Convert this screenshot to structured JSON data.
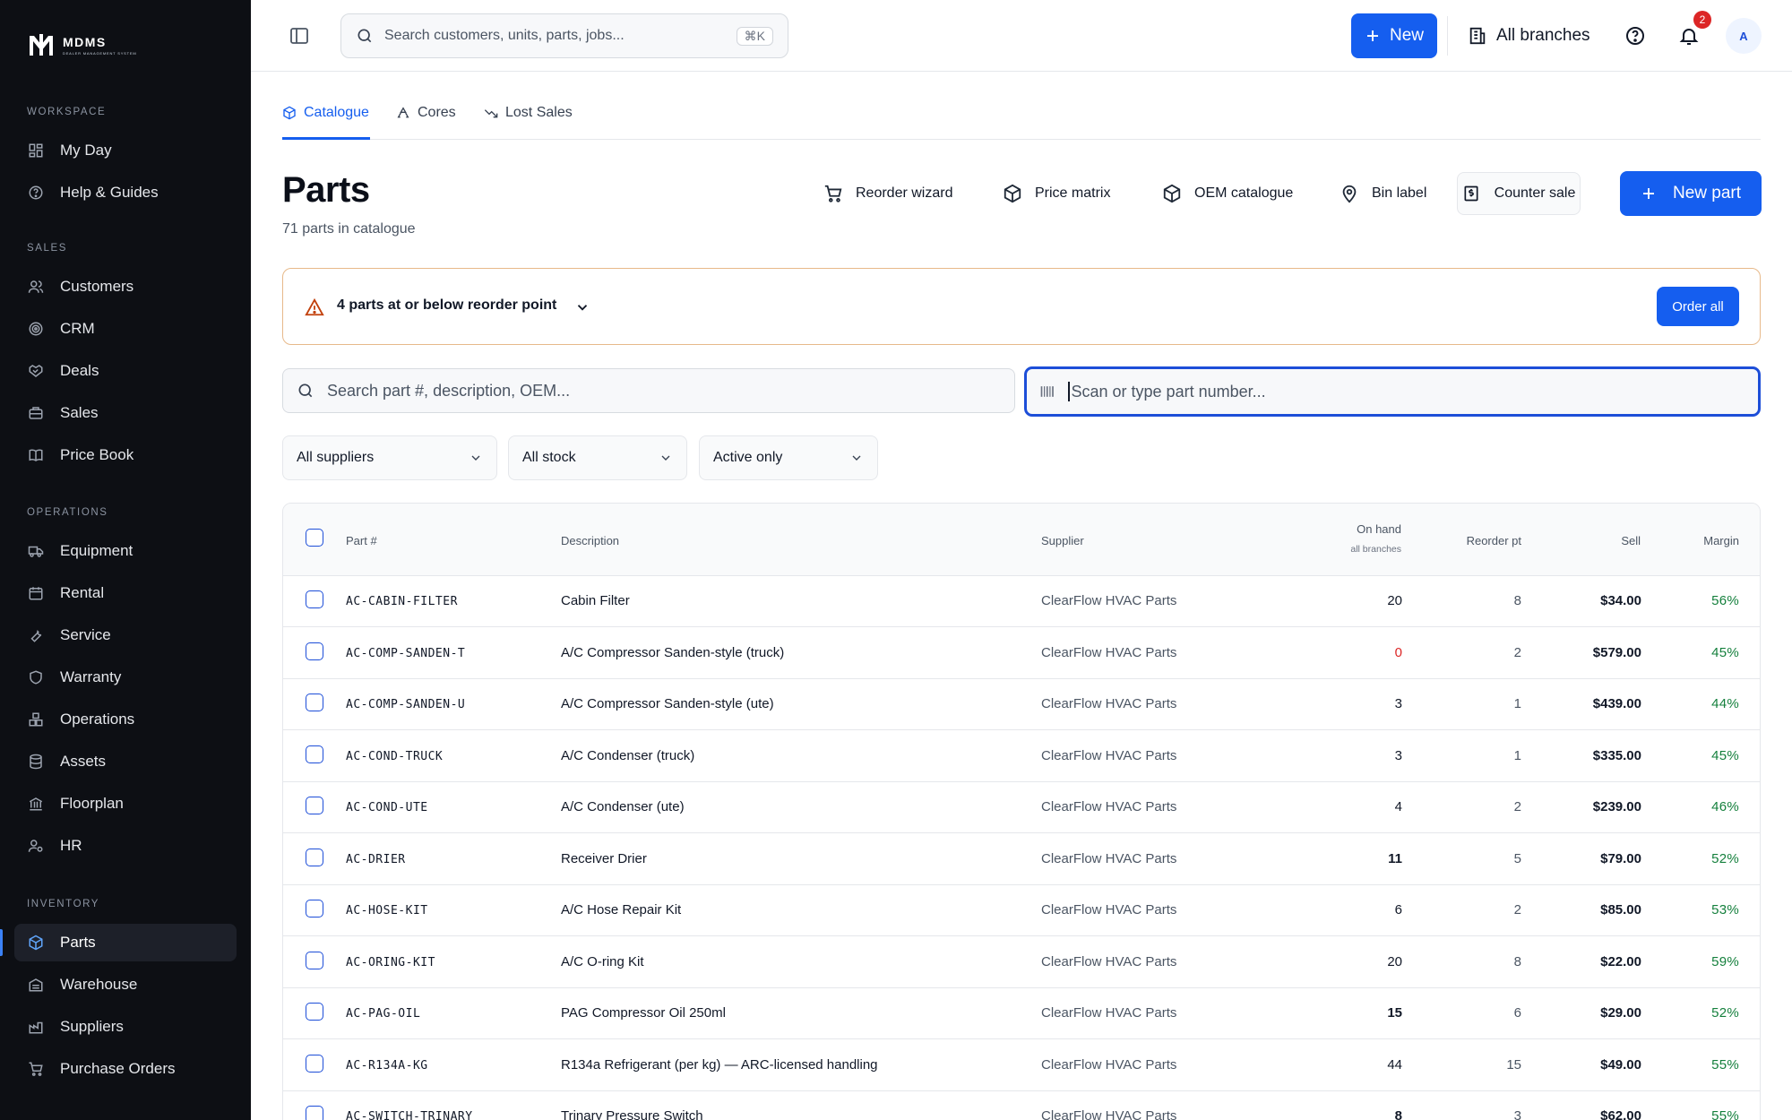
{
  "brand": {
    "name": "MDMS",
    "tagline": "Dealer Management System"
  },
  "sidebar": {
    "sections": [
      {
        "heading": "WORKSPACE",
        "items": [
          {
            "label": "My Day",
            "icon": "dashboard-icon"
          },
          {
            "label": "Help & Guides",
            "icon": "help-circle-icon"
          }
        ]
      },
      {
        "heading": "SALES",
        "items": [
          {
            "label": "Customers",
            "icon": "users-icon"
          },
          {
            "label": "CRM",
            "icon": "target-icon"
          },
          {
            "label": "Deals",
            "icon": "handshake-icon"
          },
          {
            "label": "Sales",
            "icon": "briefcase-icon"
          },
          {
            "label": "Price Book",
            "icon": "book-icon"
          }
        ]
      },
      {
        "heading": "OPERATIONS",
        "items": [
          {
            "label": "Equipment",
            "icon": "truck-icon"
          },
          {
            "label": "Rental",
            "icon": "calendar-icon"
          },
          {
            "label": "Service",
            "icon": "wrench-icon"
          },
          {
            "label": "Warranty",
            "icon": "shield-icon"
          },
          {
            "label": "Operations",
            "icon": "boxes-icon"
          },
          {
            "label": "Assets",
            "icon": "database-icon"
          },
          {
            "label": "Floorplan",
            "icon": "bank-icon"
          },
          {
            "label": "HR",
            "icon": "user-cog-icon"
          }
        ]
      },
      {
        "heading": "INVENTORY",
        "items": [
          {
            "label": "Parts",
            "icon": "package-icon",
            "active": true
          },
          {
            "label": "Warehouse",
            "icon": "warehouse-icon"
          },
          {
            "label": "Suppliers",
            "icon": "factory-icon"
          },
          {
            "label": "Purchase Orders",
            "icon": "cart-icon"
          }
        ]
      }
    ]
  },
  "topbar": {
    "search_placeholder": "Search customers, units, parts, jobs...",
    "search_shortcut": "⌘K",
    "new_label": "New",
    "branch_label": "All branches",
    "notification_count": "2",
    "avatar_initial": "A"
  },
  "tabs": [
    {
      "label": "Catalogue",
      "icon": "package-icon",
      "active": true
    },
    {
      "label": "Cores",
      "icon": "recycle-icon"
    },
    {
      "label": "Lost Sales",
      "icon": "trending-down-icon"
    }
  ],
  "page": {
    "title": "Parts",
    "subtitle": "71 parts in catalogue"
  },
  "actions": {
    "reorder_wizard": "Reorder wizard",
    "price_matrix": "Price matrix",
    "oem_catalogue": "OEM catalogue",
    "bin_label": "Bin label",
    "counter_sale": "Counter sale",
    "new_part": "New part"
  },
  "alert": {
    "text": "4 parts at or below reorder point",
    "button": "Order all"
  },
  "search": {
    "part_placeholder": "Search part #, description, OEM...",
    "scan_placeholder": "Scan or type part number..."
  },
  "filters": {
    "supplier": "All suppliers",
    "stock": "All stock",
    "status": "Active only"
  },
  "table": {
    "headers": {
      "part": "Part #",
      "description": "Description",
      "supplier": "Supplier",
      "on_hand": "On hand",
      "on_hand_sub": "all branches",
      "reorder": "Reorder pt",
      "sell": "Sell",
      "margin": "Margin"
    },
    "rows": [
      {
        "part": "AC-CABIN-FILTER",
        "description": "Cabin Filter",
        "supplier": "ClearFlow HVAC Parts",
        "on_hand": "20",
        "reorder": "8",
        "sell": "$34.00",
        "margin": "56%"
      },
      {
        "part": "AC-COMP-SANDEN-T",
        "description": "A/C Compressor Sanden-style (truck)",
        "supplier": "ClearFlow HVAC Parts",
        "on_hand": "0",
        "reorder": "2",
        "sell": "$579.00",
        "margin": "45%"
      },
      {
        "part": "AC-COMP-SANDEN-U",
        "description": "A/C Compressor Sanden-style (ute)",
        "supplier": "ClearFlow HVAC Parts",
        "on_hand": "3",
        "reorder": "1",
        "sell": "$439.00",
        "margin": "44%"
      },
      {
        "part": "AC-COND-TRUCK",
        "description": "A/C Condenser (truck)",
        "supplier": "ClearFlow HVAC Parts",
        "on_hand": "3",
        "reorder": "1",
        "sell": "$335.00",
        "margin": "45%"
      },
      {
        "part": "AC-COND-UTE",
        "description": "A/C Condenser (ute)",
        "supplier": "ClearFlow HVAC Parts",
        "on_hand": "4",
        "reorder": "2",
        "sell": "$239.00",
        "margin": "46%"
      },
      {
        "part": "AC-DRIER",
        "description": "Receiver Drier",
        "supplier": "ClearFlow HVAC Parts",
        "on_hand": "11",
        "reorder": "5",
        "sell": "$79.00",
        "margin": "52%"
      },
      {
        "part": "AC-HOSE-KIT",
        "description": "A/C Hose Repair Kit",
        "supplier": "ClearFlow HVAC Parts",
        "on_hand": "6",
        "reorder": "2",
        "sell": "$85.00",
        "margin": "53%"
      },
      {
        "part": "AC-ORING-KIT",
        "description": "A/C O-ring Kit",
        "supplier": "ClearFlow HVAC Parts",
        "on_hand": "20",
        "reorder": "8",
        "sell": "$22.00",
        "margin": "59%"
      },
      {
        "part": "AC-PAG-OIL",
        "description": "PAG Compressor Oil 250ml",
        "supplier": "ClearFlow HVAC Parts",
        "on_hand": "15",
        "reorder": "6",
        "sell": "$29.00",
        "margin": "52%"
      },
      {
        "part": "AC-R134A-KG",
        "description": "R134a Refrigerant (per kg) — ARC-licensed handling",
        "supplier": "ClearFlow HVAC Parts",
        "on_hand": "44",
        "reorder": "15",
        "sell": "$49.00",
        "margin": "55%"
      },
      {
        "part": "AC-SWITCH-TRINARY",
        "description": "Trinary Pressure Switch",
        "supplier": "ClearFlow HVAC Parts",
        "on_hand": "8",
        "reorder": "3",
        "sell": "$62.00",
        "margin": "55%"
      }
    ]
  }
}
